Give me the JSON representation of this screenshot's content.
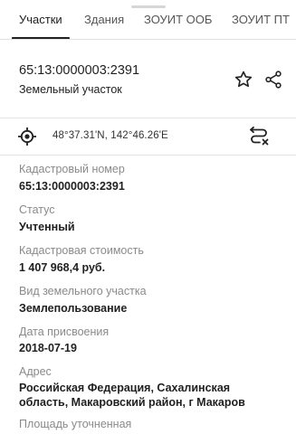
{
  "tabs": [
    {
      "label": "Участки"
    },
    {
      "label": "Здания"
    },
    {
      "label": "ЗОУИТ ООБ"
    },
    {
      "label": "ЗОУИТ ПТ"
    }
  ],
  "header": {
    "title": "65:13:0000003:2391",
    "subtitle": "Земельный участок"
  },
  "coords": {
    "text": "48°37.31'N, 142°46.26'E"
  },
  "fields": [
    {
      "label": "Кадастровый номер",
      "value": "65:13:0000003:2391"
    },
    {
      "label": "Статус",
      "value": "Учтенный"
    },
    {
      "label": "Кадастровая стоимость",
      "value": "1 407 968,4 руб."
    },
    {
      "label": "Вид земельного участка",
      "value": "Землепользование"
    },
    {
      "label": "Дата присвоения",
      "value": "2018-07-19"
    },
    {
      "label": "Адрес",
      "value_line1": "Российская Федерация, Сахалинская",
      "value_line2": "область, Макаровский район, г Макаров"
    },
    {
      "label": "Площадь уточненная"
    }
  ],
  "colors": {
    "accent": "#212121",
    "muted": "#8a8a8a",
    "divider": "#e4e4e4"
  },
  "icons": [
    "star-icon",
    "share-icon",
    "target-icon",
    "route-icon"
  ]
}
